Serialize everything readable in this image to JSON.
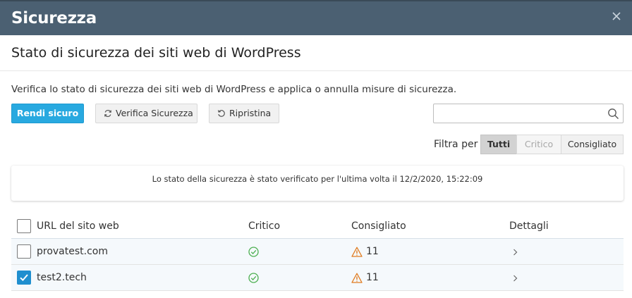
{
  "window": {
    "title": "Sicurezza",
    "close_icon": "close-icon"
  },
  "page": {
    "heading": "Stato di sicurezza dei siti web di WordPress",
    "description": "Verifica lo stato di sicurezza dei siti web di WordPress e applica o annulla misure di sicurezza."
  },
  "toolbar": {
    "secure_label": "Rendi sicuro",
    "verify_label": "Verifica Sicurezza",
    "verify_icon": "refresh-icon",
    "restore_label": "Ripristina",
    "restore_icon": "restore-icon",
    "search_placeholder": "",
    "search_value": "",
    "search_icon": "search-icon"
  },
  "filter": {
    "label": "Filtra per",
    "options": [
      "Tutti",
      "Critico",
      "Consigliato"
    ],
    "selected": "Tutti"
  },
  "status_message": "Lo stato della sicurezza è stato verificato per l'ultima volta il 12/2/2020, 15:22:09",
  "table": {
    "columns": [
      "URL del sito web",
      "Critico",
      "Consigliato",
      "Dettagli"
    ],
    "rows": [
      {
        "url": "provatest.com",
        "checked": false,
        "critical": "ok",
        "recommended": "11"
      },
      {
        "url": "test2.tech",
        "checked": true,
        "critical": "ok",
        "recommended": "11"
      }
    ]
  },
  "colors": {
    "title_bar": "#4b6072",
    "primary_button": "#28a9e0",
    "ok_icon": "#4caf50",
    "warning_icon": "#e07b1f",
    "checkbox_checked": "#1f8fcf"
  }
}
